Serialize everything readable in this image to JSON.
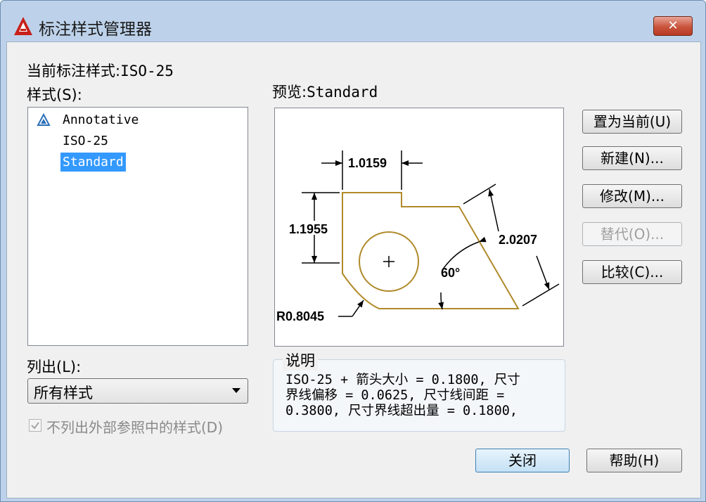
{
  "window": {
    "title": "标注样式管理器",
    "close_glyph": "✕",
    "accent": "#c9543c"
  },
  "current_style": {
    "label": "当前标注样式:",
    "value": "ISO-25"
  },
  "styles": {
    "label": "样式(S):",
    "items": [
      "Annotative",
      "ISO-25",
      "Standard"
    ],
    "selected": "Standard"
  },
  "preview": {
    "label": "预览:",
    "name": "Standard",
    "dims": {
      "top_width": "1.0159",
      "left_height": "1.1955",
      "slant": "2.0207",
      "angle": "60°",
      "radius": "R0.8045"
    }
  },
  "buttons": {
    "set_current": "置为当前(U)",
    "new": "新建(N)...",
    "modify": "修改(M)...",
    "override": "替代(O)...",
    "compare": "比较(C)...",
    "close": "关闭",
    "help": "帮助(H)"
  },
  "list_filter": {
    "label": "列出(L):",
    "value": "所有样式"
  },
  "xref_option": {
    "label": "不列出外部参照中的样式(D)",
    "checked": true,
    "enabled": false
  },
  "description": {
    "title": "说明",
    "lines": [
      "ISO-25 + 箭头大小 = 0.1800, 尺寸",
      "界线偏移 = 0.0625, 尺寸线间距 =",
      "0.3800, 尺寸界线超出量 = 0.1800,"
    ]
  }
}
